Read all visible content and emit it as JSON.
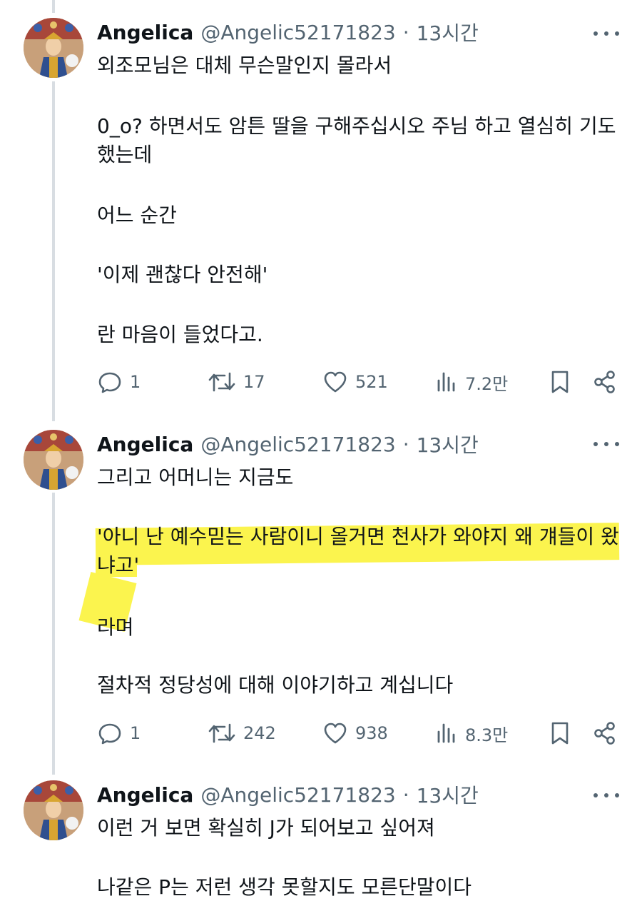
{
  "tweets": [
    {
      "author": {
        "name": "Angelica",
        "handle": "@Angelic52171823",
        "time": "13시간"
      },
      "separator": "·",
      "lines": [
        "외조모님은 대체 무슨말인지 몰라서",
        "0_o? 하면서도 암튼 딸을 구해주십시오 주님 하고 열심히 기도",
        "했는데",
        "어느 순간",
        "'이제 괜찮다 안전해'",
        "란 마음이 들었다고."
      ],
      "stats": {
        "replies": "1",
        "reposts": "17",
        "likes": "521",
        "views": "7.2만"
      }
    },
    {
      "author": {
        "name": "Angelica",
        "handle": "@Angelic52171823",
        "time": "13시간"
      },
      "separator": "·",
      "lines": [
        "그리고 어머니는 지금도",
        "'아니 난 예수믿는 사람이니 올거면 천사가 와야지 왜 걔들이 왔",
        "냐고'",
        "라며",
        "절차적 정당성에 대해 이야기하고 계십니다"
      ],
      "highlight_color": "#fbf44e",
      "stats": {
        "replies": "1",
        "reposts": "242",
        "likes": "938",
        "views": "8.3만"
      }
    },
    {
      "author": {
        "name": "Angelica",
        "handle": "@Angelic52171823",
        "time": "13시간"
      },
      "separator": "·",
      "lines": [
        "이런 거 보면 확실히 J가 되어보고 싶어져",
        "나같은 P는 저런 생각 못할지도 모른단말이다"
      ]
    }
  ],
  "icons": [
    "reply-icon",
    "repost-icon",
    "like-icon",
    "views-icon",
    "bookmark-icon",
    "share-icon",
    "more-icon"
  ],
  "colors": {
    "text": "#0f1419",
    "muted": "#536471",
    "thread_line": "#d8dde2",
    "highlight": "#fbf44e"
  }
}
